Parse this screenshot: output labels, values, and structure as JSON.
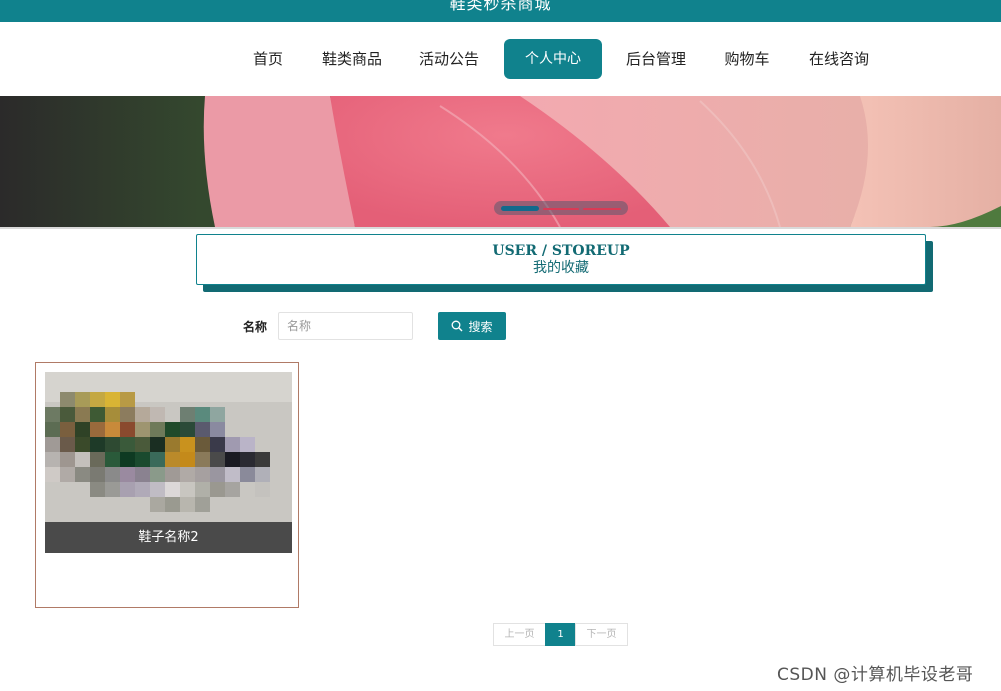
{
  "header": {
    "site_title": "鞋类秒杀商城"
  },
  "nav": {
    "items": [
      {
        "label": "首页"
      },
      {
        "label": "鞋类商品"
      },
      {
        "label": "活动公告"
      },
      {
        "label": "个人中心",
        "active": true
      },
      {
        "label": "后台管理"
      },
      {
        "label": "购物车"
      },
      {
        "label": "在线咨询"
      }
    ]
  },
  "banner": {
    "slide_count": 3,
    "active_slide": 1
  },
  "section": {
    "title_en": "USER / STOREUP",
    "title_cn": "我的收藏"
  },
  "search": {
    "label": "名称",
    "placeholder": "名称",
    "value": "",
    "button_label": "搜索"
  },
  "favorites": [
    {
      "name": "鞋子名称2"
    }
  ],
  "pagination": {
    "prev_label": "上一页",
    "current_page": "1",
    "next_label": "下一页"
  },
  "watermark": "CSDN @计算机毕设老哥",
  "colors": {
    "primary": "#10828d",
    "primary_dark": "#126a73",
    "card_border": "#b07a66",
    "caption_bg": "#4a4a4a"
  }
}
